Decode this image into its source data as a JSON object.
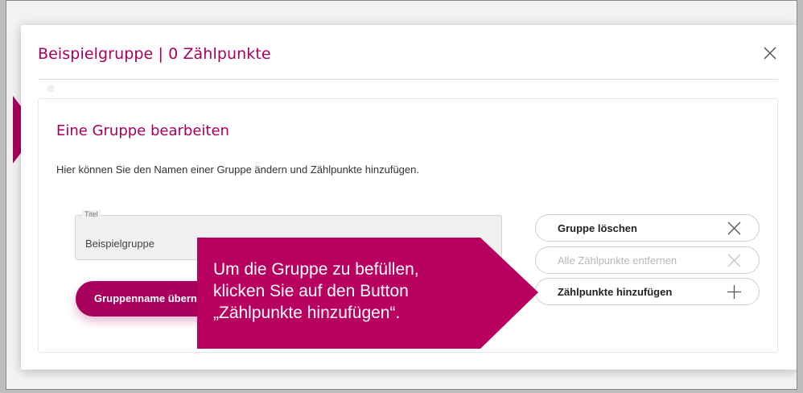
{
  "modal": {
    "title": "Beispielgruppe | 0 Zählpunkte",
    "close_icon": "close-icon"
  },
  "card": {
    "title": "Eine Gruppe bearbeiten",
    "description": "Hier können Sie den Namen einer Gruppe ändern und Zählpunkte hinzufügen."
  },
  "title_field": {
    "label": "Titel",
    "value": "Beispielgruppe"
  },
  "rename_button": {
    "label": "Gruppenname übernehmen"
  },
  "actions": {
    "delete_group": "Gruppe löschen",
    "remove_all": "Alle Zählpunkte entfernen",
    "add_points": "Zählpunkte hinzufügen"
  },
  "callout": {
    "text": "Um die Gruppe zu befüllen,\nklicken Sie auf den Button\n„Zählpunkte hinzufügen“."
  },
  "colors": {
    "brand": "#a8005c",
    "disabled": "#b8b8b8"
  },
  "icons": {
    "delete": "close-icon",
    "remove_all": "close-icon",
    "add": "plus-icon"
  }
}
